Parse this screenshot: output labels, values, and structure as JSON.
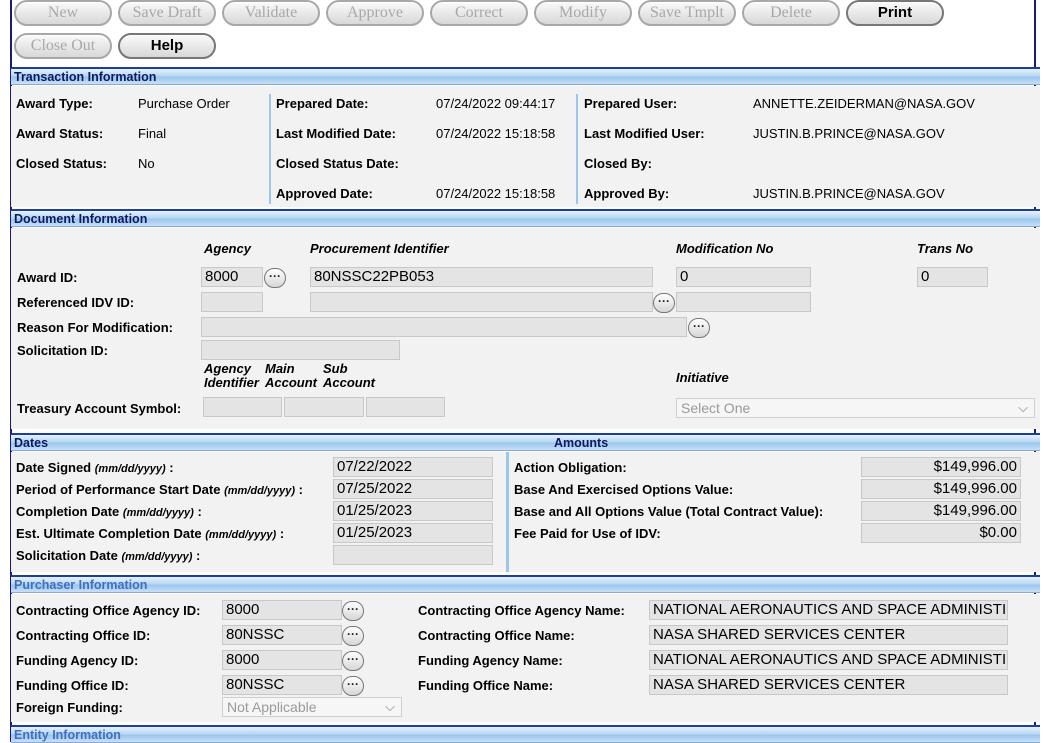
{
  "toolbar": {
    "new": "New",
    "save_draft": "Save Draft",
    "validate": "Validate",
    "approve": "Approve",
    "correct": "Correct",
    "modify": "Modify",
    "save_template": "Save Tmplt",
    "delete": "Delete",
    "print": "Print",
    "close_out": "Close Out",
    "help": "Help"
  },
  "transaction": {
    "title": "Transaction Information",
    "award_type_label": "Award Type:",
    "award_type": "Purchase Order",
    "award_status_label": "Award Status:",
    "award_status": "Final",
    "closed_status_label": "Closed Status:",
    "closed_status": "No",
    "prepared_date_label": "Prepared Date:",
    "prepared_date": "07/24/2022 09:44:17",
    "last_modified_date_label": "Last Modified Date:",
    "last_modified_date": "07/24/2022 15:18:58",
    "closed_status_date_label": "Closed Status Date:",
    "approved_date_label": "Approved Date:",
    "approved_date": "07/24/2022 15:18:58",
    "prepared_user_label": "Prepared User:",
    "prepared_user": "ANNETTE.ZEIDERMAN@NASA.GOV",
    "last_modified_user_label": "Last Modified User:",
    "last_modified_user": "JUSTIN.B.PRINCE@NASA.GOV",
    "closed_by_label": "Closed By:",
    "approved_by_label": "Approved By:",
    "approved_by": "JUSTIN.B.PRINCE@NASA.GOV"
  },
  "document": {
    "title": "Document Information",
    "col_agency": "Agency",
    "col_procurement": "Procurement Identifier",
    "col_modification": "Modification No",
    "col_trans": "Trans No",
    "award_id_label": "Award ID:",
    "award_agency": "8000",
    "award_procurement": "80NSSC22PB053",
    "award_modification": "0",
    "award_trans": "0",
    "ref_idv_label": "Referenced IDV ID:",
    "reason_label": "Reason For Modification:",
    "solicitation_label": "Solicitation ID:",
    "col_agency_identifier": "Agency Identifier",
    "col_main_account": "Main Account",
    "col_sub_account": "Sub Account",
    "col_initiative": "Initiative",
    "tas_label": "Treasury Account Symbol:",
    "initiative_placeholder": "Select One"
  },
  "dates": {
    "title": "Dates",
    "date_signed_label": "Date Signed",
    "date_signed": "07/22/2022",
    "pop_start_label": "Period of Performance Start Date",
    "pop_start": "07/25/2022",
    "completion_label": "Completion Date",
    "completion": "01/25/2023",
    "est_ultimate_label": "Est. Ultimate Completion Date",
    "est_ultimate": "01/25/2023",
    "solicitation_date_label": "Solicitation Date",
    "date_format": "(mm/dd/yyyy)",
    "colon": ":"
  },
  "amounts": {
    "title": "Amounts",
    "action_obligation_label": "Action Obligation:",
    "action_obligation": "$149,996.00",
    "base_exercised_label": "Base And Exercised Options Value:",
    "base_exercised": "$149,996.00",
    "base_all_label": "Base and All Options Value (Total Contract Value):",
    "base_all": "$149,996.00",
    "fee_paid_label": "Fee Paid for Use of IDV:",
    "fee_paid": "$0.00"
  },
  "purchaser": {
    "title": "Purchaser Information",
    "co_agency_id_label": "Contracting Office Agency ID:",
    "co_agency_id": "8000",
    "co_id_label": "Contracting Office ID:",
    "co_id": "80NSSC",
    "funding_agency_id_label": "Funding Agency ID:",
    "funding_agency_id": "8000",
    "funding_office_id_label": "Funding Office ID:",
    "funding_office_id": "80NSSC",
    "foreign_funding_label": "Foreign Funding:",
    "foreign_funding": "Not Applicable",
    "co_agency_name_label": "Contracting Office Agency Name:",
    "co_agency_name": "NATIONAL AERONAUTICS AND SPACE ADMINISTI",
    "co_name_label": "Contracting Office Name:",
    "co_name": "NASA SHARED SERVICES CENTER",
    "funding_agency_name_label": "Funding Agency Name:",
    "funding_agency_name": "NATIONAL AERONAUTICS AND SPACE ADMINISTI",
    "funding_office_name_label": "Funding Office Name:",
    "funding_office_name": "NASA SHARED SERVICES CENTER"
  },
  "entity": {
    "title": "Entity Information"
  },
  "icons": {
    "lookup": "ellipsis-lookup-icon",
    "dropdown": "chevron-down-icon",
    "lookup_glyph": "···",
    "chevron_glyph": "⌵"
  }
}
